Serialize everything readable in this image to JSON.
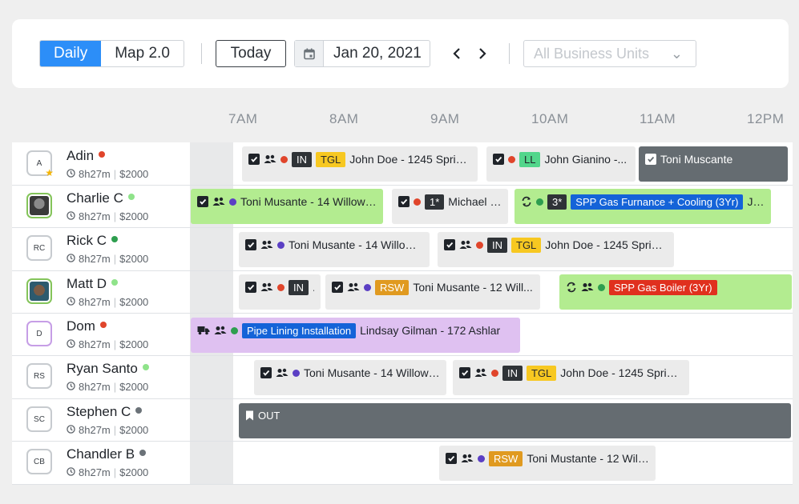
{
  "toolbar": {
    "view_daily": "Daily",
    "view_map": "Map 2.0",
    "today": "Today",
    "date": "Jan 20, 2021",
    "business_units": "All Business Units"
  },
  "hours": [
    "7AM",
    "8AM",
    "9AM",
    "10AM",
    "11AM",
    "12PM"
  ],
  "colors": {
    "accent": "#2c8ef8",
    "dot_red": "#e0452b",
    "dot_green": "#8fe38a",
    "dot_dkgreen": "#2e9e4f",
    "dot_gray": "#6b7278",
    "dot_purple": "#5b3fc4"
  },
  "techs": [
    {
      "initials": "A",
      "name": "Adin",
      "time": "8h27m",
      "amount": "$2000"
    },
    {
      "initials": "",
      "name": "Charlie C",
      "time": "8h27m",
      "amount": "$2000"
    },
    {
      "initials": "RC",
      "name": "Rick C",
      "time": "8h27m",
      "amount": "$2000"
    },
    {
      "initials": "",
      "name": "Matt D",
      "time": "8h27m",
      "amount": "$2000"
    },
    {
      "initials": "D",
      "name": "Dom",
      "time": "8h27m",
      "amount": "$2000"
    },
    {
      "initials": "RS",
      "name": "Ryan Santo",
      "time": "8h27m",
      "amount": "$2000"
    },
    {
      "initials": "SC",
      "name": "Stephen C",
      "time": "8h27m",
      "amount": "$2000"
    },
    {
      "initials": "CB",
      "name": "Chandler B",
      "time": "8h27m",
      "amount": "$2000"
    }
  ],
  "jobs": {
    "adin_1": {
      "tag1": "IN",
      "tag2": "TGL",
      "text": "John Doe - 1245 Sprin..."
    },
    "adin_2": {
      "tag1": "LL",
      "text": "John Gianino -..."
    },
    "adin_3": {
      "text": "Toni Muscante"
    },
    "charlie_1": {
      "text": "Toni Musante - 14 Willow ..."
    },
    "charlie_2": {
      "tag1": "1*",
      "text": "Michael H..."
    },
    "charlie_3": {
      "tag1": "3*",
      "tag2": "SPP Gas Furnance + Cooling (3Yr)",
      "text": "Joh..."
    },
    "rick_1": {
      "text": "Toni Musante - 14 Willow ..."
    },
    "rick_2": {
      "tag1": "IN",
      "tag2": "TGL",
      "text": "John Doe - 1245 Spring ..."
    },
    "matt_1": {
      "tag1": "IN",
      "text": "..."
    },
    "matt_2": {
      "tag1": "RSW",
      "text": "Toni Musante - 12 Will..."
    },
    "matt_3": {
      "tag1": "SPP Gas Boiler (3Yr)"
    },
    "dom_1": {
      "tag1": "Pipe Lining Installation",
      "text": "Lindsay Gilman - 172 Ashlar"
    },
    "ryan_1": {
      "text": "Toni Musante - 14 Willow ..."
    },
    "ryan_2": {
      "tag1": "IN",
      "tag2": "TGL",
      "text": "John Doe - 1245 Spring ..."
    },
    "stephen_1": {
      "text": "OUT"
    },
    "chandler_1": {
      "tag1": "RSW",
      "text": "Toni Mustante - 12 Will..."
    }
  }
}
